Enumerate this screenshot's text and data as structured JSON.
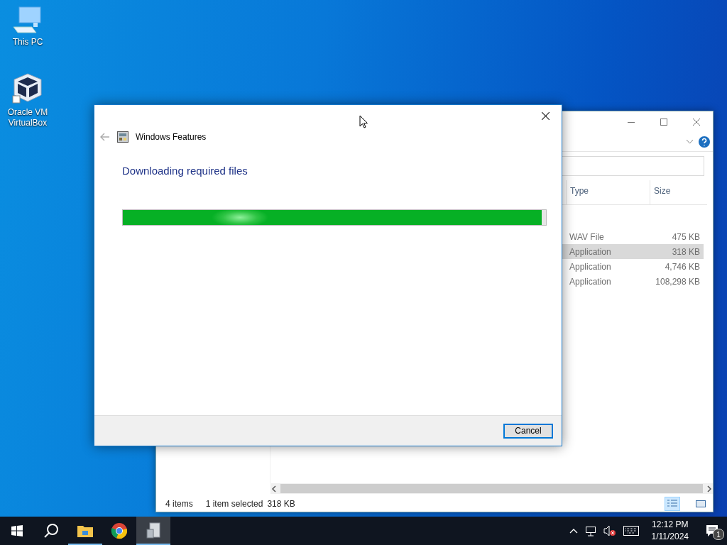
{
  "desktop_icons": [
    {
      "kind": "computer",
      "label": "This PC"
    },
    {
      "kind": "virtualbox",
      "label": "Oracle VM VirtualBox"
    }
  ],
  "explorer": {
    "columns": [
      "Type",
      "Size"
    ],
    "rows": [
      {
        "type": "WAV File",
        "size": "475 KB",
        "selected": false
      },
      {
        "type": "Application",
        "size": "318 KB",
        "selected": true
      },
      {
        "type": "Application",
        "size": "4,746 KB",
        "selected": false
      },
      {
        "type": "Application",
        "size": "108,298 KB",
        "selected": false
      }
    ],
    "status": {
      "items": "4 items",
      "selection": "1 item selected",
      "size": "318 KB"
    }
  },
  "dialog": {
    "title": "Windows Features",
    "heading": "Downloading required files",
    "progress": {
      "level": 0.99
    },
    "buttons": [
      "Cancel"
    ]
  },
  "taskbar": {
    "apps": [
      {
        "kind": "explorer",
        "running": true,
        "selected": false
      },
      {
        "kind": "chrome",
        "running": false,
        "selected": false
      },
      {
        "kind": "features",
        "running": true,
        "selected": true
      }
    ],
    "tray": {
      "volume_muted": true,
      "time": "12:12 PM",
      "date": "1/11/2024",
      "notifications": "1"
    }
  }
}
